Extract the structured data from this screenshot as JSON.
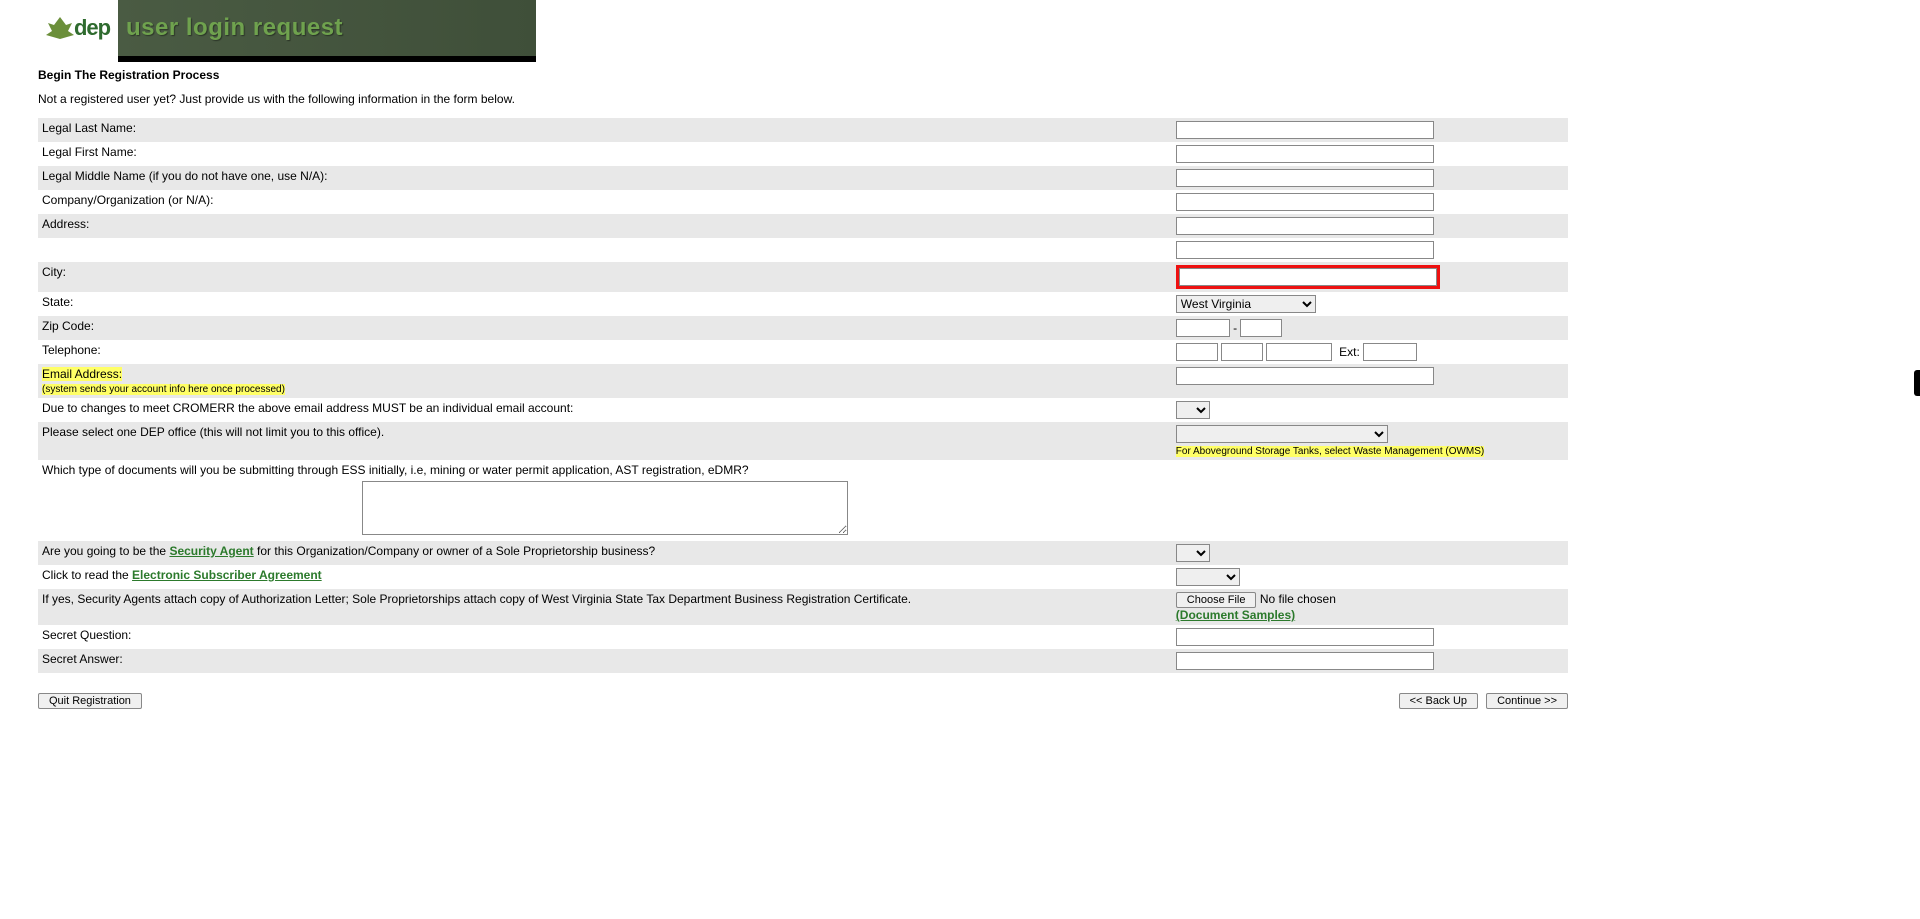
{
  "banner": {
    "logo_text": "dep",
    "title": "user login request"
  },
  "section_title": "Begin The Registration Process",
  "intro": "Not a registered user yet? Just provide us with the following information in the form below.",
  "labels": {
    "last_name": "Legal Last Name:",
    "first_name": "Legal First Name:",
    "middle_name": "Legal Middle Name (if you do not have one, use N/A):",
    "company": "Company/Organization (or N/A):",
    "address": "Address:",
    "city": "City:",
    "state": "State:",
    "zip": "Zip Code:",
    "telephone": "Telephone:",
    "ext": "Ext:",
    "email": "Email Address:",
    "email_note": "(system sends your account info here once processed)",
    "cromerr": "Due to changes to meet CROMERR the above email address MUST be an individual email account:",
    "dep_office": "Please select one DEP office (this will not limit you to this office).",
    "dep_office_note": "For Aboveground Storage Tanks, select Waste Management (OWMS)",
    "doc_type": "Which type of documents will you be submitting through ESS initially, i.e, mining or water permit application, AST registration, eDMR?",
    "security_agent_pre": "Are you going to be the ",
    "security_agent_link": "Security Agent",
    "security_agent_post": " for this Organization/Company or owner of a Sole Proprietorship business?",
    "esa_pre": "Click to read the ",
    "esa_link": "Electronic Subscriber Agreement",
    "attach": "If yes, Security Agents attach copy of Authorization Letter; Sole Proprietorships attach copy of West Virginia State Tax Department Business Registration Certificate.",
    "doc_samples": "(Document Samples)",
    "secret_q": "Secret Question:",
    "secret_a": "Secret Answer:"
  },
  "values": {
    "state_selected": "West Virginia",
    "file_button": "Choose File",
    "file_status": "No file chosen"
  },
  "buttons": {
    "quit": "Quit Registration",
    "back": "<<  Back Up",
    "continue": "Continue  >>"
  }
}
